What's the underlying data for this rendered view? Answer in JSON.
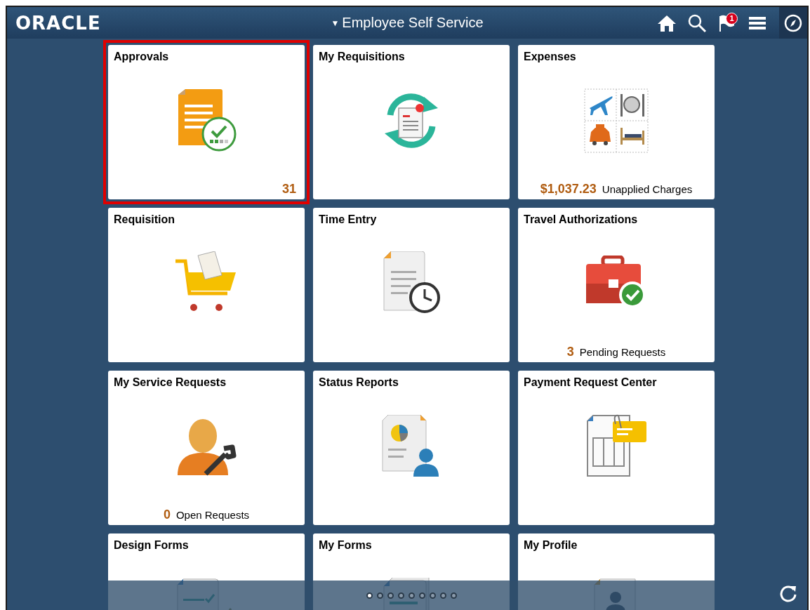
{
  "header": {
    "logo": "ORACLE",
    "title": "Employee Self Service",
    "title_caret": "▼",
    "notification_count": "1"
  },
  "tiles": [
    {
      "title": "Approvals",
      "kind": "approvals",
      "highlighted": true,
      "count": "31"
    },
    {
      "title": "My Requisitions",
      "kind": "requisitions",
      "highlighted": false
    },
    {
      "title": "Expenses",
      "kind": "expenses",
      "highlighted": false,
      "count": "$1,037.23",
      "count_label": "Unapplied Charges"
    },
    {
      "title": "Requisition",
      "kind": "cart",
      "highlighted": false
    },
    {
      "title": "Time Entry",
      "kind": "time",
      "highlighted": false
    },
    {
      "title": "Travel Authorizations",
      "kind": "travel",
      "highlighted": false,
      "count": "3",
      "count_label": "Pending Requests"
    },
    {
      "title": "My Service Requests",
      "kind": "service",
      "highlighted": false,
      "count": "0",
      "count_label": "Open Requests"
    },
    {
      "title": "Status Reports",
      "kind": "reports",
      "highlighted": false
    },
    {
      "title": "Payment Request Center",
      "kind": "payment",
      "highlighted": false
    },
    {
      "title": "Design Forms",
      "kind": "design",
      "highlighted": false
    },
    {
      "title": "My Forms",
      "kind": "forms",
      "highlighted": false
    },
    {
      "title": "My Profile",
      "kind": "profile",
      "highlighted": false
    }
  ],
  "page_dots": [
    {
      "selected": true
    },
    {
      "selected": false
    },
    {
      "selected": false
    },
    {
      "selected": false
    },
    {
      "selected": false
    },
    {
      "selected": false
    },
    {
      "selected": false
    },
    {
      "selected": false
    },
    {
      "selected": false
    }
  ]
}
